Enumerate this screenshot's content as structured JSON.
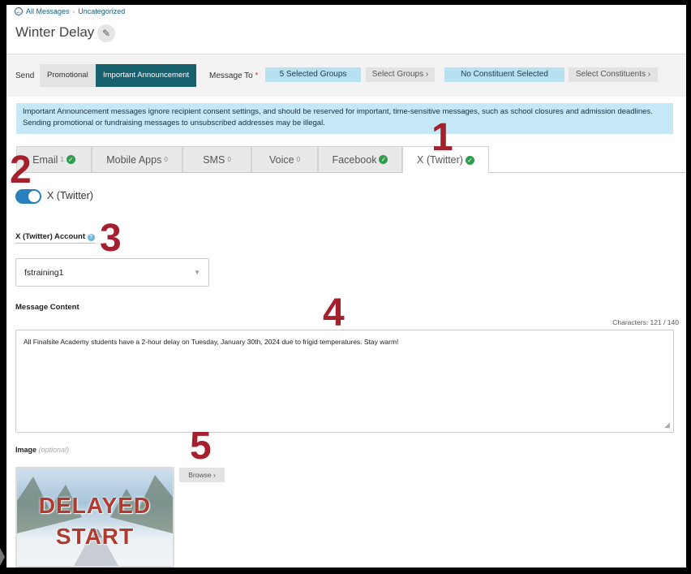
{
  "breadcrumb": {
    "back": "All Messages",
    "current": "Uncategorized"
  },
  "page_title": "Winter Delay",
  "send": {
    "label": "Send",
    "options": [
      "Promotional",
      "Important Announcement"
    ],
    "selected": "Important Announcement"
  },
  "message_to": {
    "label": "Message To",
    "required_mark": "*",
    "groups_value": "5 Selected Groups",
    "groups_button": "Select Groups",
    "constituents_value": "No Constituent Selected",
    "constituents_button": "Select Constituents"
  },
  "info_text": "Important Announcement messages ignore recipient consent settings, and should be reserved for important, time-sensitive messages, such as school closures and admission deadlines. Sending promotional or fundraising messages to unsubscribed addresses may be illegal.",
  "tabs": [
    {
      "label": "Email",
      "count": "1",
      "checked": true
    },
    {
      "label": "Mobile Apps",
      "count": "0",
      "checked": false
    },
    {
      "label": "SMS",
      "count": "0",
      "checked": false
    },
    {
      "label": "Voice",
      "count": "0",
      "checked": false
    },
    {
      "label": "Facebook",
      "count": "",
      "checked": true
    },
    {
      "label": "X (Twitter)",
      "count": "",
      "checked": true,
      "active": true
    }
  ],
  "toggle": {
    "label": "X (Twitter)",
    "on": true
  },
  "account": {
    "label": "X (Twitter) Account",
    "value": "fstraining1"
  },
  "message_content": {
    "label": "Message Content",
    "chars": "Characters: 121 / 140",
    "text": "All Finalsite Academy students have a 2-hour delay on Tuesday, January 30th, 2024 due to frigid temperatures. Stay warm!"
  },
  "image": {
    "label": "Image",
    "optional": "(optional)",
    "browse": "Browse",
    "thumbnail_text": [
      "DELAYED",
      "START"
    ]
  },
  "callouts": [
    "1",
    "2",
    "3",
    "4",
    "5"
  ],
  "colors": {
    "accent": "#17606e",
    "info_bg": "#c5e8f6",
    "callout": "#a4202c",
    "check": "#2e9d4e",
    "toggle": "#2a7fbf"
  }
}
